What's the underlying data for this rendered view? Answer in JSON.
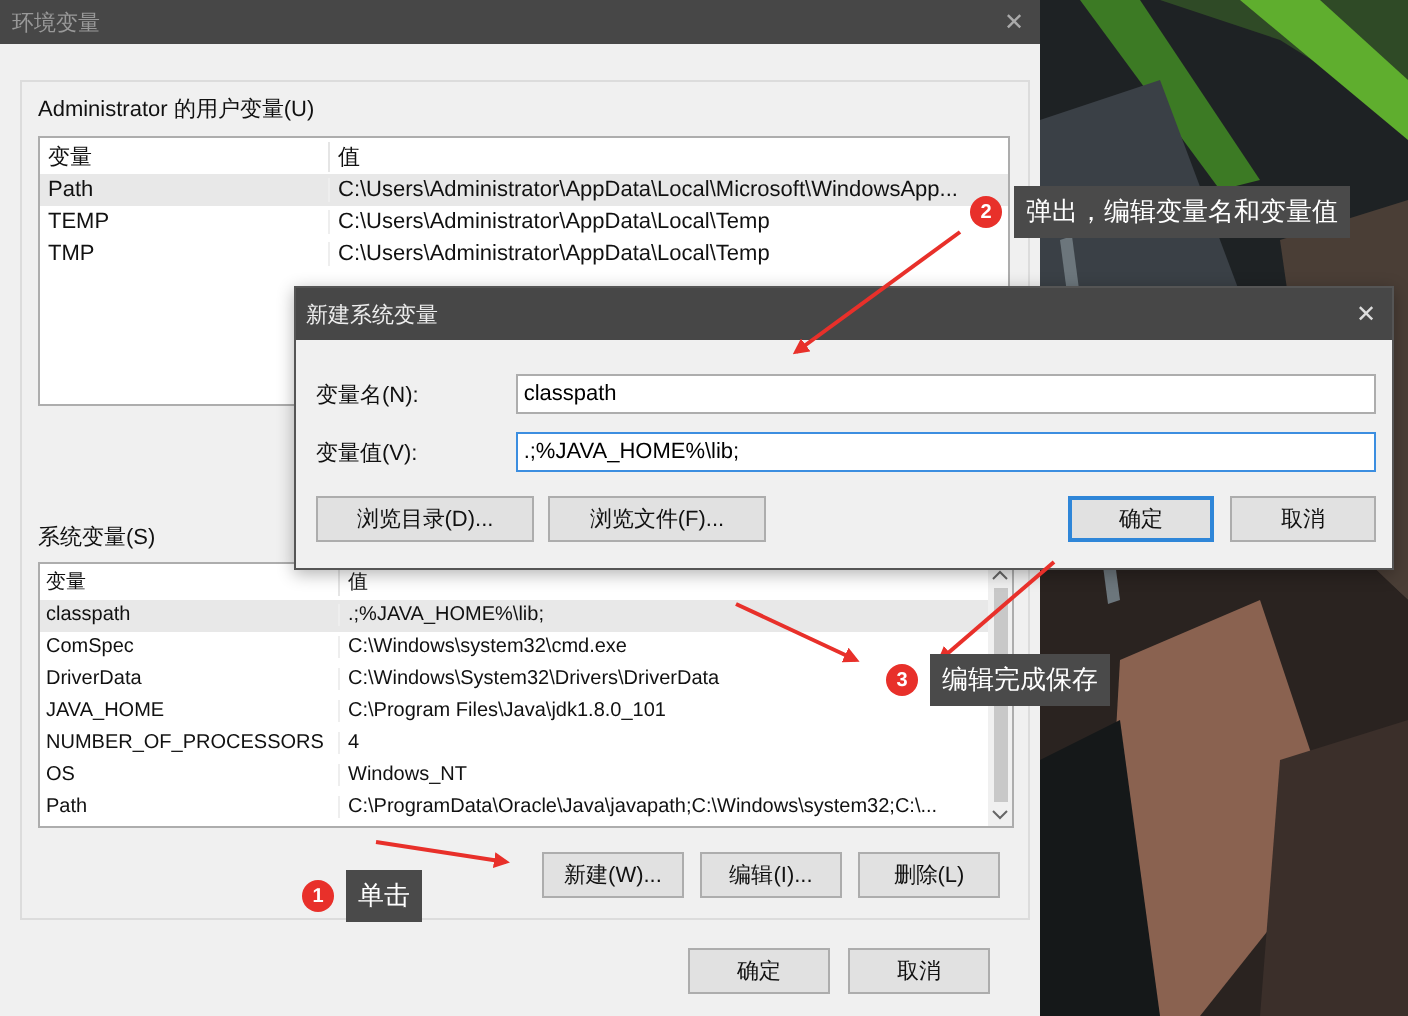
{
  "window": {
    "title": "环境变量",
    "close": "✕"
  },
  "user_vars": {
    "title": "Administrator 的用户变量(U)",
    "columns": [
      "变量",
      "值"
    ],
    "rows": [
      {
        "name": "Path",
        "value": "C:\\Users\\Administrator\\AppData\\Local\\Microsoft\\WindowsApp...",
        "selected": true
      },
      {
        "name": "TEMP",
        "value": "C:\\Users\\Administrator\\AppData\\Local\\Temp",
        "selected": false
      },
      {
        "name": "TMP",
        "value": "C:\\Users\\Administrator\\AppData\\Local\\Temp",
        "selected": false
      }
    ]
  },
  "system_vars": {
    "title": "系统变量(S)",
    "columns": [
      "变量",
      "值"
    ],
    "rows": [
      {
        "name": "classpath",
        "value": ".;%JAVA_HOME%\\lib;",
        "selected": true
      },
      {
        "name": "ComSpec",
        "value": "C:\\Windows\\system32\\cmd.exe",
        "selected": false
      },
      {
        "name": "DriverData",
        "value": "C:\\Windows\\System32\\Drivers\\DriverData",
        "selected": false
      },
      {
        "name": "JAVA_HOME",
        "value": "C:\\Program Files\\Java\\jdk1.8.0_101",
        "selected": false
      },
      {
        "name": "NUMBER_OF_PROCESSORS",
        "value": "4",
        "selected": false
      },
      {
        "name": "OS",
        "value": "Windows_NT",
        "selected": false
      },
      {
        "name": "Path",
        "value": "C:\\ProgramData\\Oracle\\Java\\javapath;C:\\Windows\\system32;C:\\...",
        "selected": false
      }
    ],
    "buttons": [
      "新建(W)...",
      "编辑(I)...",
      "删除(L)"
    ]
  },
  "footer_buttons": [
    "确定",
    "取消"
  ],
  "dialog": {
    "title": "新建系统变量",
    "close": "✕",
    "fields": [
      {
        "label": "变量名(N):",
        "value": "classpath",
        "focused": false
      },
      {
        "label": "变量值(V):",
        "value": ".;%JAVA_HOME%\\lib;",
        "focused": true
      }
    ],
    "buttons": [
      {
        "label": "浏览目录(D)...",
        "default": false
      },
      {
        "label": "浏览文件(F)...",
        "default": false
      },
      {
        "label": "确定",
        "default": true
      },
      {
        "label": "取消",
        "default": false
      }
    ]
  },
  "callouts": [
    {
      "number": "2",
      "text": "弹出，编辑变量名和变量值"
    },
    {
      "number": "3",
      "text": "编辑完成保存"
    },
    {
      "number": "1",
      "text": "单击"
    }
  ]
}
